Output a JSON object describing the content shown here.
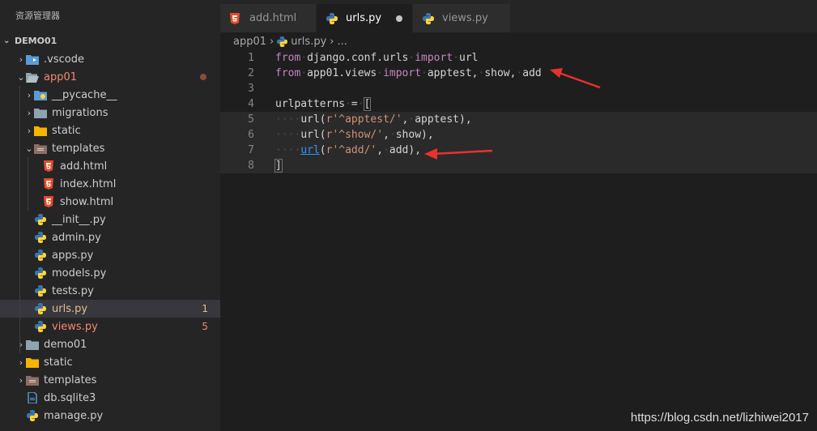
{
  "explorer": {
    "title": "资源管理器",
    "section": "DEMO01",
    "items": [
      {
        "label": ".vscode",
        "depth": 1,
        "chevron": "›",
        "icon": "vscode-folder-icon"
      },
      {
        "label": "app01",
        "depth": 1,
        "chevron": "⌄",
        "icon": "open-folder-icon",
        "modified": true
      },
      {
        "label": "__pycache__",
        "depth": 2,
        "chevron": "›",
        "icon": "python-folder-icon"
      },
      {
        "label": "migrations",
        "depth": 2,
        "chevron": "›",
        "icon": "folder-icon"
      },
      {
        "label": "static",
        "depth": 2,
        "chevron": "›",
        "icon": "static-folder-icon"
      },
      {
        "label": "templates",
        "depth": 2,
        "chevron": "⌄",
        "icon": "templates-folder-icon"
      },
      {
        "label": "add.html",
        "depth": 3,
        "icon": "html-file-icon"
      },
      {
        "label": "index.html",
        "depth": 3,
        "icon": "html-file-icon"
      },
      {
        "label": "show.html",
        "depth": 3,
        "icon": "html-file-icon"
      },
      {
        "label": "__init__.py",
        "depth": 2,
        "icon": "python-file-icon"
      },
      {
        "label": "admin.py",
        "depth": 2,
        "icon": "python-file-icon"
      },
      {
        "label": "apps.py",
        "depth": 2,
        "icon": "python-file-icon"
      },
      {
        "label": "models.py",
        "depth": 2,
        "icon": "python-file-icon"
      },
      {
        "label": "tests.py",
        "depth": 2,
        "icon": "python-file-icon"
      },
      {
        "label": "urls.py",
        "depth": 2,
        "icon": "python-file-icon",
        "badge": "1",
        "color": "#e2c08d",
        "selected": true
      },
      {
        "label": "views.py",
        "depth": 2,
        "icon": "python-file-icon",
        "badge": "5",
        "color": "#f48771"
      },
      {
        "label": "demo01",
        "depth": 1,
        "chevron": "›",
        "icon": "folder-icon"
      },
      {
        "label": "static",
        "depth": 1,
        "chevron": "›",
        "icon": "static-folder-icon"
      },
      {
        "label": "templates",
        "depth": 1,
        "chevron": "›",
        "icon": "templates-folder-icon"
      },
      {
        "label": "db.sqlite3",
        "depth": 1,
        "icon": "database-file-icon"
      },
      {
        "label": "manage.py",
        "depth": 1,
        "icon": "python-file-icon"
      }
    ]
  },
  "tabs": [
    {
      "label": "add.html",
      "icon": "html-file-icon",
      "active": false
    },
    {
      "label": "urls.py",
      "icon": "python-file-icon",
      "active": true,
      "dirty": true
    },
    {
      "label": "views.py",
      "icon": "python-file-icon",
      "active": false
    }
  ],
  "breadcrumb": {
    "folder": "app01",
    "sep1": "›",
    "file": "urls.py",
    "sep2": "›",
    "tail": "..."
  },
  "editor": {
    "line_numbers": [
      "1",
      "2",
      "3",
      "4",
      "5",
      "6",
      "7",
      "8"
    ],
    "lines": [
      "from django.conf.urls import url",
      "from app01.views import apptest, show, add",
      "",
      "urlpatterns = [",
      "    url(r'^apptest/', apptest),",
      "    url(r'^show/', show),",
      "    url(r'^add/', add),",
      "]"
    ]
  },
  "watermark": "https://blog.csdn.net/lizhiwei2017",
  "colors": {
    "annotation_arrow": "#e8322c",
    "keyword": "#c586c0",
    "string": "#ce9178"
  }
}
